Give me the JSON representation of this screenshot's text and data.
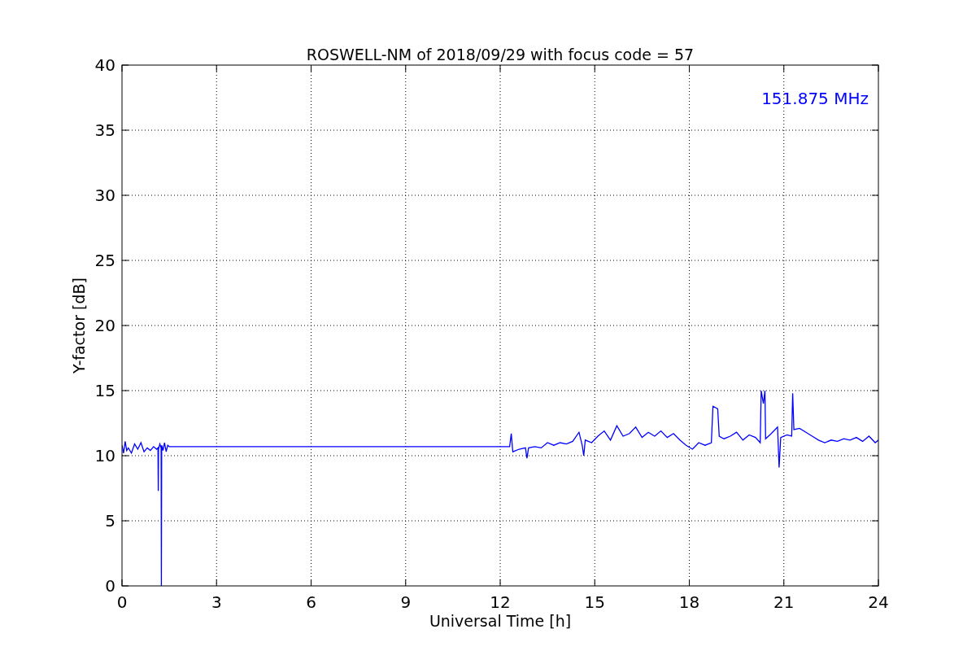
{
  "figure": {
    "chart_data": {
      "type": "line",
      "title": "ROSWELL-NM of 2018/09/29 with focus code = 57",
      "xlabel": "Universal Time [h]",
      "ylabel": "Y-factor [dB]",
      "xlim": [
        0,
        24
      ],
      "ylim": [
        0,
        40
      ],
      "xticks": [
        0,
        3,
        6,
        9,
        12,
        15,
        18,
        21,
        24
      ],
      "yticks": [
        0,
        5,
        10,
        15,
        20,
        25,
        30,
        35,
        40
      ],
      "x": [
        0,
        0.05,
        0.1,
        0.15,
        0.2,
        0.3,
        0.4,
        0.5,
        0.6,
        0.7,
        0.8,
        0.9,
        1.0,
        1.1,
        1.14,
        1.15,
        1.16,
        1.2,
        1.24,
        1.25,
        1.26,
        1.3,
        1.35,
        1.4,
        1.45,
        1.5,
        12.3,
        12.35,
        12.4,
        12.6,
        12.8,
        12.85,
        12.9,
        13.1,
        13.3,
        13.5,
        13.7,
        13.9,
        14.1,
        14.3,
        14.5,
        14.6,
        14.65,
        14.7,
        14.9,
        15.1,
        15.3,
        15.5,
        15.7,
        15.9,
        16.1,
        16.3,
        16.5,
        16.7,
        16.9,
        17.1,
        17.3,
        17.5,
        17.7,
        17.9,
        18.1,
        18.3,
        18.5,
        18.7,
        18.75,
        18.9,
        18.95,
        19.1,
        19.3,
        19.5,
        19.7,
        19.9,
        20.1,
        20.25,
        20.28,
        20.35,
        20.4,
        20.42,
        20.6,
        20.8,
        20.85,
        20.9,
        21.1,
        21.25,
        21.28,
        21.32,
        21.5,
        21.7,
        21.9,
        22.1,
        22.3,
        22.5,
        22.7,
        22.9,
        23.1,
        23.3,
        23.5,
        23.7,
        23.9,
        24.0
      ],
      "series": [
        {
          "name": "151.875 MHz",
          "color": "#0000ff",
          "values": [
            10.8,
            10.2,
            11.1,
            10.4,
            10.6,
            10.2,
            10.9,
            10.5,
            11.0,
            10.3,
            10.6,
            10.4,
            10.7,
            10.5,
            10.6,
            7.3,
            10.5,
            10.9,
            10.6,
            0,
            10.8,
            10.4,
            11.0,
            10.3,
            10.8,
            10.7,
            10.7,
            11.7,
            10.3,
            10.5,
            10.6,
            9.8,
            10.6,
            10.7,
            10.6,
            11.0,
            10.8,
            11.0,
            10.9,
            11.1,
            11.8,
            10.8,
            10.0,
            11.2,
            11.0,
            11.5,
            11.9,
            11.2,
            12.3,
            11.5,
            11.7,
            12.2,
            11.4,
            11.8,
            11.5,
            11.9,
            11.4,
            11.7,
            11.2,
            10.8,
            10.5,
            11.0,
            10.8,
            11.0,
            13.8,
            13.6,
            11.5,
            11.3,
            11.5,
            11.8,
            11.2,
            11.6,
            11.4,
            11.0,
            15.0,
            14.0,
            15.0,
            11.3,
            11.7,
            12.2,
            9.1,
            11.4,
            11.6,
            11.5,
            14.8,
            12.0,
            12.1,
            11.8,
            11.5,
            11.2,
            11.0,
            11.2,
            11.1,
            11.3,
            11.2,
            11.4,
            11.1,
            11.5,
            11.0,
            11.2
          ]
        }
      ],
      "grid": true
    }
  }
}
